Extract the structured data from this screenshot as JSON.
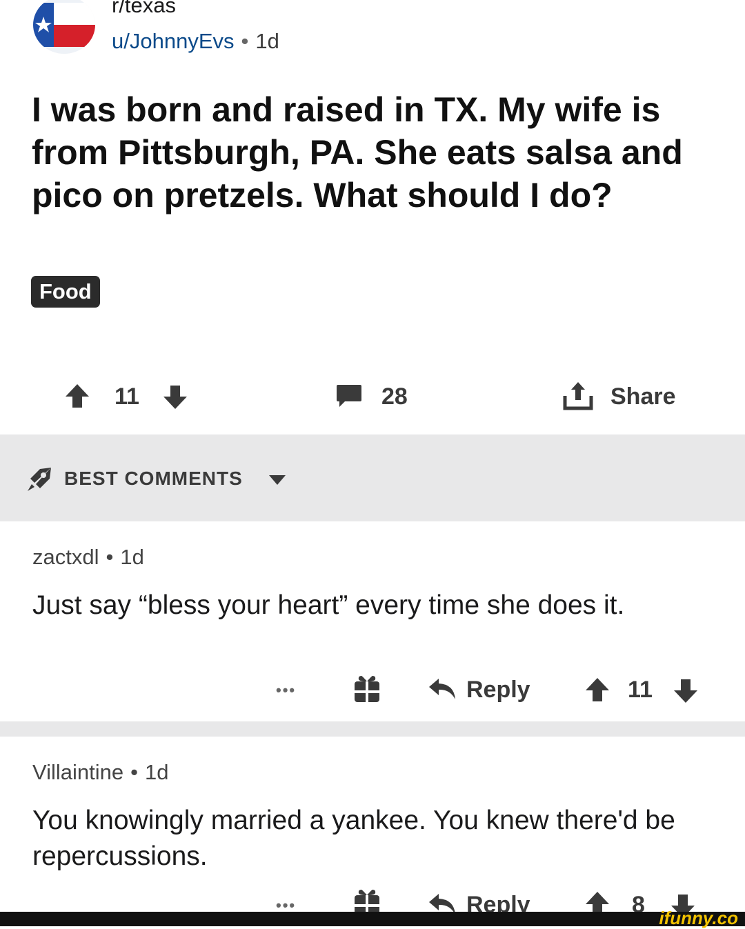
{
  "header": {
    "subreddit": "r/texas",
    "username": "u/JohnnyEvs",
    "separator": "•",
    "age": "1d"
  },
  "post": {
    "title": "I was born and raised in TX. My wife is from Pittsburgh, PA. She eats salsa and pico on pretzels. What should I do?",
    "flair": "Food",
    "upvotes": "11",
    "comments": "28",
    "share_label": "Share"
  },
  "section": {
    "label": "BEST COMMENTS"
  },
  "comments": [
    {
      "author": "zactxdl",
      "age": "1d",
      "body": "Just say “bless your heart” every time she does it.",
      "more": "•••",
      "reply_label": "Reply",
      "score": "11"
    },
    {
      "author": "Villaintine",
      "age": "1d",
      "body": "You knowingly married a yankee. You knew there'd be repercussions.",
      "more": "•••",
      "reply_label": "Reply",
      "score": "8"
    }
  ],
  "watermark": "ifunny.co",
  "colors": {
    "username": "#0b4a8a",
    "flair_bg": "#2b2b2b",
    "band_bg": "#e8e8e9",
    "icon": "#3a3a3a",
    "watermark": "#f2c200"
  },
  "icons": [
    "texas-flag-avatar",
    "upvote-icon",
    "downvote-icon",
    "comment-icon",
    "share-icon",
    "rocket-icon",
    "caret-down-icon",
    "more-icon",
    "gift-icon",
    "reply-icon"
  ]
}
